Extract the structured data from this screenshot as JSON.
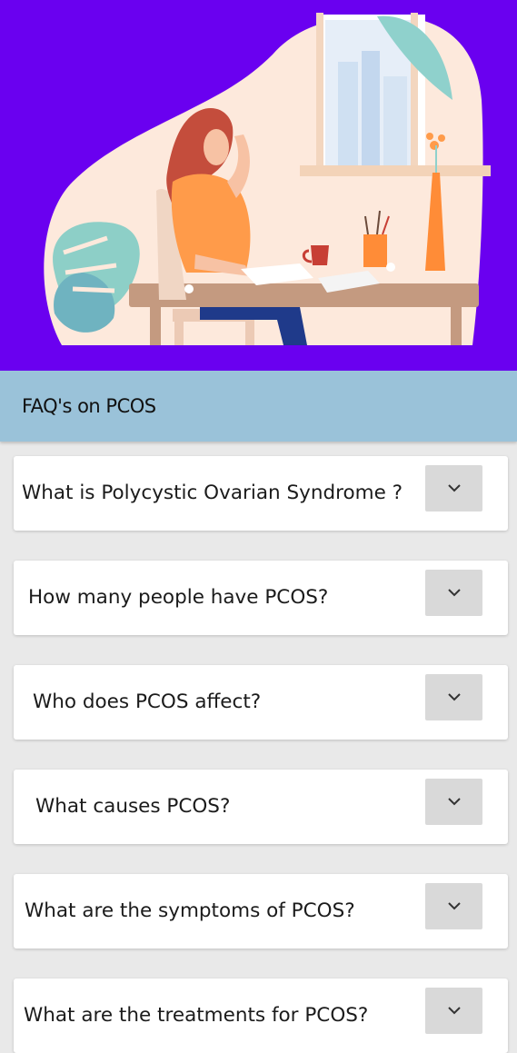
{
  "header": {
    "title": "FAQ's on PCOS"
  },
  "faq": {
    "items": [
      {
        "question": "What is Polycystic Ovarian Syndrome ?"
      },
      {
        "question": "How many people have PCOS?"
      },
      {
        "question": "Who does PCOS affect?"
      },
      {
        "question": "What causes PCOS?"
      },
      {
        "question": "What are the symptoms of PCOS?"
      },
      {
        "question": "What are the treatments for PCOS?"
      }
    ],
    "toggle_icon": "chevron-down-icon"
  },
  "colors": {
    "hero_background": "#6a00f0",
    "header_background": "#9ac2d9",
    "page_background": "#e9e9e9",
    "card_background": "#ffffff",
    "toggle_background": "#d9d9d9"
  }
}
